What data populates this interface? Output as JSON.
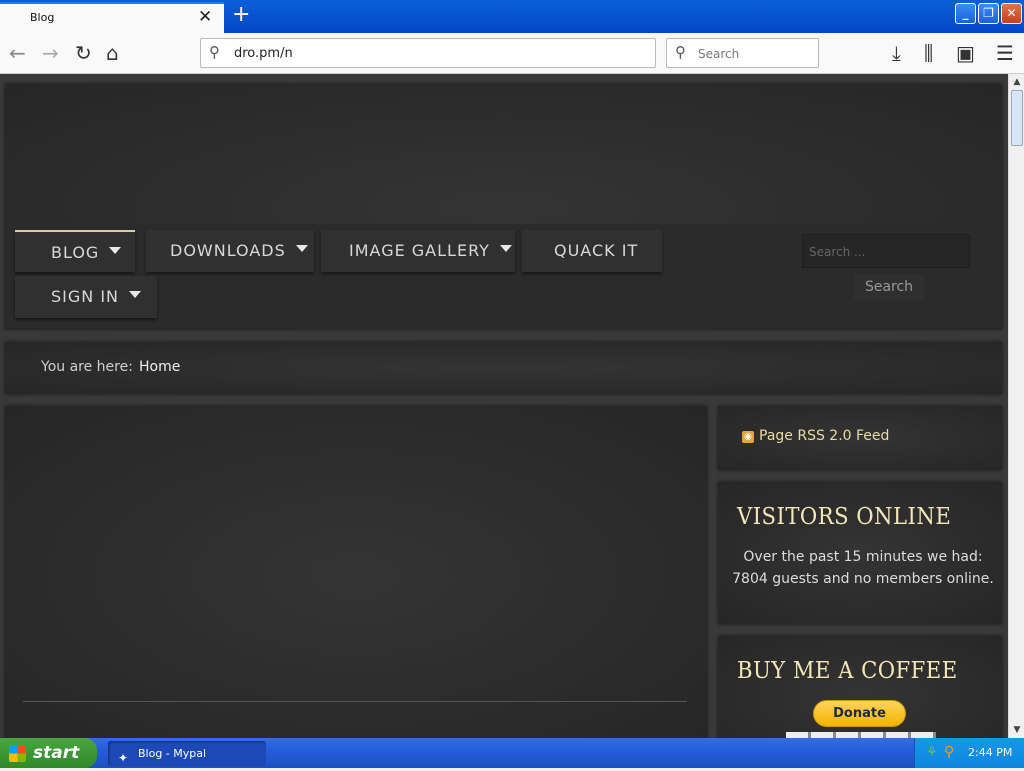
{
  "browser": {
    "tab_title": "Blog",
    "tab_close": "✕",
    "new_tab": "+",
    "url": "dro.pm/n",
    "search_placeholder": "Search"
  },
  "window_controls": {
    "minimize": "_",
    "maximize": "❐",
    "close": "✕"
  },
  "site": {
    "menu": [
      {
        "label": "BLOG",
        "dropdown": true
      },
      {
        "label": "DOWNLOADS",
        "dropdown": true
      },
      {
        "label": "IMAGE GALLERY",
        "dropdown": true
      },
      {
        "label": "QUACK IT",
        "dropdown": false
      },
      {
        "label": "SIGN IN",
        "dropdown": true
      }
    ],
    "search_placeholder": "Search ...",
    "search_button": "Search",
    "breadcrumb_label": "You are here:",
    "breadcrumb_home": "Home",
    "rss_label": "Page RSS 2.0 Feed",
    "visitors_title": "VISITORS ONLINE",
    "visitors_text": "Over the past 15 minutes we had: 7804 guests and no members online.",
    "coffee_title": "BUY ME A COFFEE",
    "donate_label": "Donate"
  },
  "taskbar": {
    "start_label": "start",
    "task_label": "Blog - Mypal",
    "clock": "2:44 PM"
  },
  "colors": {
    "accent_gold": "#f2e7b6",
    "donate_yellow": "#ffc439",
    "page_bg": "#3a3a3a"
  }
}
